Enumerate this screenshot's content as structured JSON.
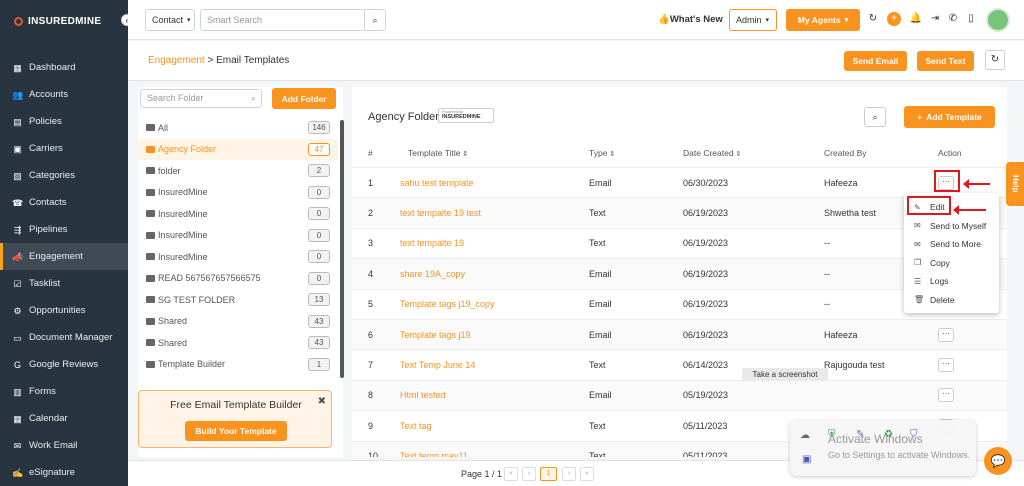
{
  "brand": {
    "name": "INSUREDMINE"
  },
  "sidebar": {
    "items": [
      {
        "label": "Dashboard",
        "icon": "dashboard-icon",
        "glyph": "▦"
      },
      {
        "label": "Accounts",
        "icon": "accounts-icon",
        "glyph": "👥"
      },
      {
        "label": "Policies",
        "icon": "policies-icon",
        "glyph": "▤"
      },
      {
        "label": "Carriers",
        "icon": "carriers-icon",
        "glyph": "▣"
      },
      {
        "label": "Categories",
        "icon": "categories-icon",
        "glyph": "▧"
      },
      {
        "label": "Contacts",
        "icon": "contacts-icon",
        "glyph": "☎"
      },
      {
        "label": "Pipelines",
        "icon": "pipelines-icon",
        "glyph": "⇶"
      },
      {
        "label": "Engagement",
        "icon": "megaphone-icon",
        "glyph": "📣",
        "active": true
      },
      {
        "label": "Tasklist",
        "icon": "tasklist-icon",
        "glyph": "☑"
      },
      {
        "label": "Opportunities",
        "icon": "opportunities-icon",
        "glyph": "⚙"
      },
      {
        "label": "Document Manager",
        "icon": "folder-icon",
        "glyph": "▭"
      },
      {
        "label": "Google Reviews",
        "icon": "google-icon",
        "glyph": "G"
      },
      {
        "label": "Forms",
        "icon": "forms-icon",
        "glyph": "▥"
      },
      {
        "label": "Calendar",
        "icon": "calendar-icon",
        "glyph": "▦"
      },
      {
        "label": "Work Email",
        "icon": "email-icon",
        "glyph": "✉"
      },
      {
        "label": "eSignature",
        "icon": "esignature-icon",
        "glyph": "✍"
      }
    ]
  },
  "topbar": {
    "contact_select": "Contact",
    "search_placeholder": "Smart Search",
    "whats_new": "What's New",
    "admin_select": "Admin",
    "my_agents": "My Agents"
  },
  "subhead": {
    "breadcrumb_root": "Engagement",
    "breadcrumb_sep": " > ",
    "breadcrumb_current": "Email Templates",
    "send_email": "Send Email",
    "send_text": "Send Text"
  },
  "folders": {
    "search_placeholder": "Search Folder",
    "add_folder": "Add Folder",
    "items": [
      {
        "label": "All",
        "count": "146"
      },
      {
        "label": "Agency Folder",
        "count": "47",
        "active": true
      },
      {
        "label": "folder",
        "count": "2"
      },
      {
        "label": "InsuredMine",
        "count": "0"
      },
      {
        "label": "InsuredMine",
        "count": "0"
      },
      {
        "label": "InsuredMine",
        "count": "0"
      },
      {
        "label": "InsuredMine",
        "count": "0"
      },
      {
        "label": "READ 567567657566575",
        "count": "0"
      },
      {
        "label": "SG TEST FOLDER",
        "count": "13"
      },
      {
        "label": "Shared",
        "count": "43"
      },
      {
        "label": "Shared",
        "count": "43"
      },
      {
        "label": "Template Builder",
        "count": "1"
      }
    ]
  },
  "promo": {
    "title": "Free Email Template Builder",
    "button": "Build Your Template"
  },
  "table": {
    "folder_title": "Agency Folder",
    "badge_prefix": "Powered by",
    "badge_brand": "INSUREDMINE",
    "add_template": "Add Template",
    "columns": [
      "#",
      "Template Title",
      "Type",
      "Date Created",
      "Created By",
      "Action"
    ],
    "rows": [
      {
        "n": "1",
        "title": "sahu test template",
        "type": "Email",
        "date": "06/30/2023",
        "by": "Hafeeza"
      },
      {
        "n": "2",
        "title": "text tempalte 19 test",
        "type": "Text",
        "date": "06/19/2023",
        "by": "Shwetha test"
      },
      {
        "n": "3",
        "title": "text tempalte 19",
        "type": "Text",
        "date": "06/19/2023",
        "by": "--"
      },
      {
        "n": "4",
        "title": "share 19A_copy",
        "type": "Email",
        "date": "06/19/2023",
        "by": "--"
      },
      {
        "n": "5",
        "title": "Template tags j19_copy",
        "type": "Email",
        "date": "06/19/2023",
        "by": "--"
      },
      {
        "n": "6",
        "title": "Template tags j19",
        "type": "Email",
        "date": "06/19/2023",
        "by": "Hafeeza"
      },
      {
        "n": "7",
        "title": "Text Temp June 14",
        "type": "Text",
        "date": "06/14/2023",
        "by": "Rajugouda test"
      },
      {
        "n": "8",
        "title": "Html tested",
        "type": "Email",
        "date": "05/19/2023",
        "by": ""
      },
      {
        "n": "9",
        "title": "Text tag",
        "type": "Text",
        "date": "05/11/2023",
        "by": ""
      },
      {
        "n": "10",
        "title": "Text temp may11",
        "type": "Text",
        "date": "05/11/2023",
        "by": ""
      }
    ],
    "action_glyph": "···"
  },
  "action_menu": {
    "items": [
      {
        "label": "Edit",
        "icon": "pencil-icon",
        "glyph": "✎"
      },
      {
        "label": "Send to Myself",
        "icon": "envelope-icon",
        "glyph": "✉"
      },
      {
        "label": "Send to More",
        "icon": "envelope-icon",
        "glyph": "✉"
      },
      {
        "label": "Copy",
        "icon": "copy-icon",
        "glyph": "❐"
      },
      {
        "label": "Logs",
        "icon": "list-icon",
        "glyph": "☰"
      },
      {
        "label": "Delete",
        "icon": "trash-icon",
        "glyph": "🗑"
      }
    ]
  },
  "pager": {
    "text": "Page 1 / 1",
    "current": "1"
  },
  "overlay": {
    "help": "Help",
    "tooltip": "Take a screenshot",
    "activate_title": "Activate Windows",
    "activate_sub": "Go to Settings to activate Windows."
  },
  "colors": {
    "accent": "#f7931e",
    "sidebar": "#283540",
    "highlight": "#e0171e"
  }
}
